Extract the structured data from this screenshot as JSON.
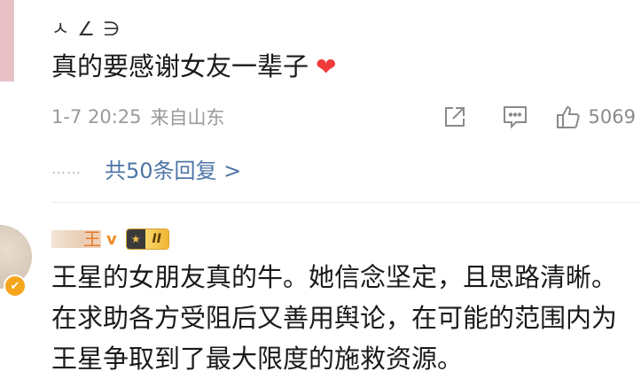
{
  "comment1": {
    "text": "真的要感谢女友一辈子",
    "heart_icon": "heart-icon",
    "time": "1-7 20:25",
    "location": "来自山东",
    "like_count": "5069",
    "dots": "……",
    "replies_label": "共50条回复 >"
  },
  "comment2": {
    "verify_badge": "✔",
    "vip_mark": "v",
    "level_icon": "★",
    "level_text": "II",
    "text": "王星的女朋友真的牛。她信念坚定，且思路清晰。在求助各方受阻后又善用舆论，在可能的范围内为王星争取到了最大限度的施救资源。"
  },
  "colors": {
    "link": "#4e76a6",
    "meta": "#9a9a9a",
    "heart": "#f23a3a",
    "vip": "#f08a24"
  }
}
